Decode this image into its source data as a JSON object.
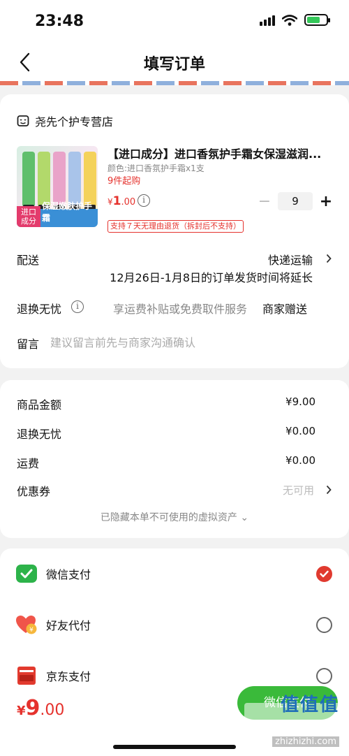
{
  "status": {
    "time": "23:48"
  },
  "nav": {
    "title": "填写订单"
  },
  "shop": {
    "name": "尧先个护专营店"
  },
  "product": {
    "title": "【进口成分】进口香氛护手霜女保湿滋润...",
    "spec": "颜色:进口香氛护手霜x1支",
    "min_qty": "9件起购",
    "price_symbol": "¥",
    "price_int": "1",
    "price_dec": ".00",
    "quantity": "9",
    "return_policy": "支持７天无理由退货（拆封后不支持）",
    "image_badge_left": "进口\n成分",
    "image_badge_text": "保湿嫩肤护手霜"
  },
  "delivery": {
    "label": "配送",
    "method": "快递运输",
    "note": "12月26日-1月8日的订单发货时间将延长"
  },
  "worry_free": {
    "label": "退换无忧",
    "service": "享运费补贴或免费取件服务",
    "gift": "商家赠送"
  },
  "memo": {
    "label": "留言",
    "placeholder": "建议留言前先与商家沟通确认"
  },
  "summary": {
    "rows": [
      {
        "label": "商品金额",
        "value": "¥9.00"
      },
      {
        "label": "退换无忧",
        "value": "¥0.00"
      },
      {
        "label": "运费",
        "value": "¥0.00"
      }
    ],
    "coupon_label": "优惠券",
    "coupon_value": "无可用",
    "hidden_assets": "已隐藏本单不可使用的虚拟资产 ⌄"
  },
  "payment": {
    "methods": [
      {
        "label": "微信支付",
        "icon": "wechat-pay-icon",
        "selected": true
      },
      {
        "label": "好友代付",
        "icon": "friend-pay-icon",
        "selected": false
      },
      {
        "label": "京东支付",
        "icon": "jd-pay-icon",
        "selected": false
      }
    ]
  },
  "footer": {
    "total_symbol": "¥",
    "total_int": "9",
    "total_dec": ".00",
    "pay_button": "微信支付",
    "watermark": "值值值",
    "watermark_url": "zhizhizhi.com"
  },
  "colors": {
    "accent_red": "#e5322d",
    "wechat_green": "#3aba3a",
    "radio_checked": "#e03a2f"
  }
}
